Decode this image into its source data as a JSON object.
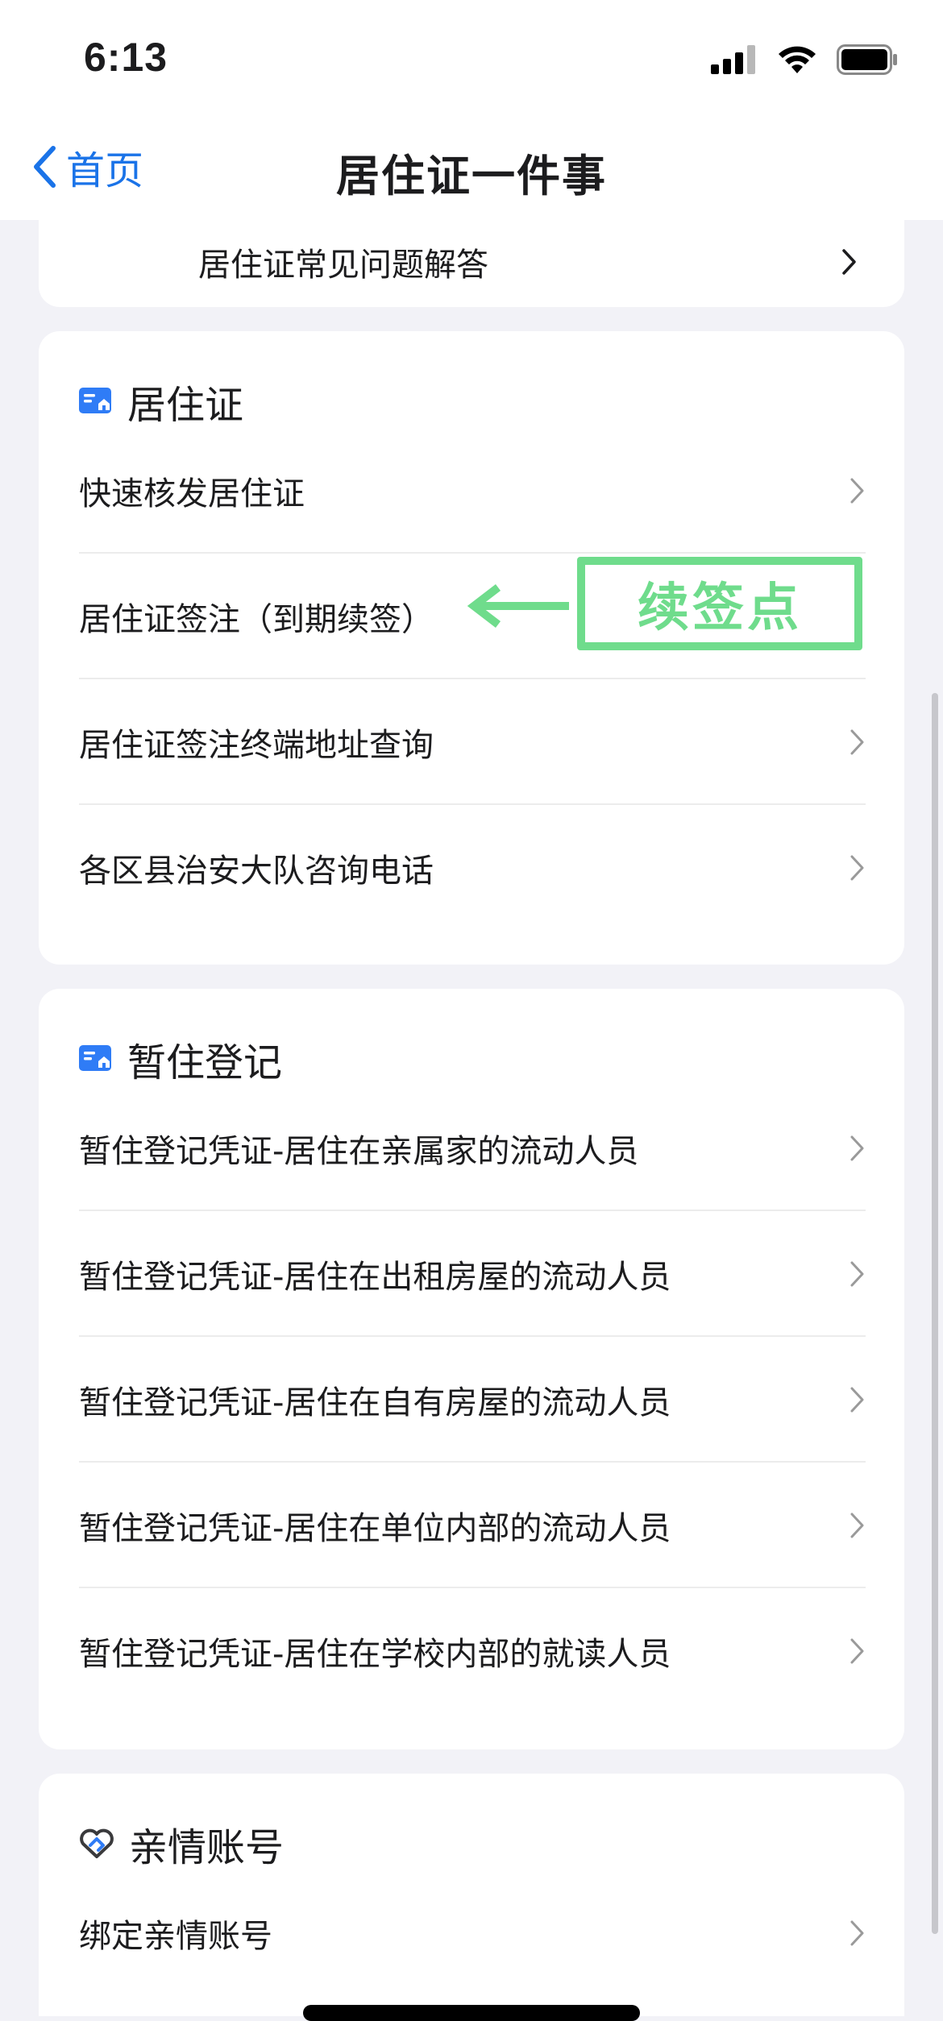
{
  "status": {
    "time": "6:13"
  },
  "nav": {
    "back_label": "首页",
    "title": "居住证一件事"
  },
  "faq": {
    "label": "居住证常见问题解答"
  },
  "residence": {
    "title": "居住证",
    "items": [
      {
        "label": "快速核发居住证"
      },
      {
        "label": "居住证签注（到期续签）"
      },
      {
        "label": "居住证签注终端地址查询"
      },
      {
        "label": "各区县治安大队咨询电话"
      }
    ]
  },
  "annotation": {
    "text": "续签点"
  },
  "temp": {
    "title": "暂住登记",
    "items": [
      {
        "label": "暂住登记凭证-居住在亲属家的流动人员"
      },
      {
        "label": "暂住登记凭证-居住在出租房屋的流动人员"
      },
      {
        "label": "暂住登记凭证-居住在自有房屋的流动人员"
      },
      {
        "label": "暂住登记凭证-居住在单位内部的流动人员"
      },
      {
        "label": "暂住登记凭证-居住在学校内部的就读人员"
      }
    ]
  },
  "family": {
    "title": "亲情账号",
    "items": [
      {
        "label": "绑定亲情账号"
      }
    ]
  },
  "colors": {
    "accent": "#1a73e8",
    "annotation": "#6fdc8c",
    "background": "#f2f2f7"
  },
  "icons": {
    "back": "chevron-left-icon",
    "faq": "megaphone-icon",
    "residence": "id-card-icon",
    "temp": "id-card-icon",
    "family": "handshake-heart-icon",
    "row": "chevron-right-icon"
  }
}
